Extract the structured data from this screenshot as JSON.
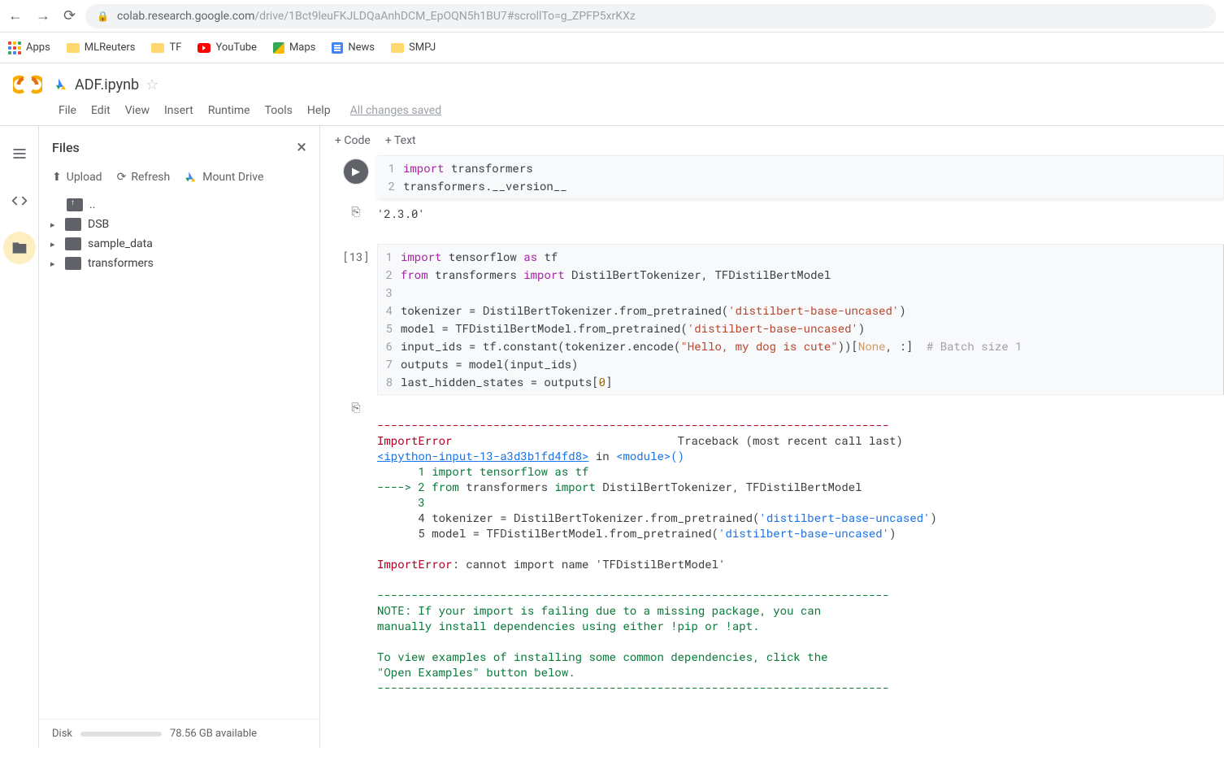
{
  "browser": {
    "url_host": "colab.research.google.com",
    "url_path": "/drive/1Bct9leuFKJLDQaAnhDCM_EpOQN5h1BU7#scrollTo=g_ZPFP5xrKXz"
  },
  "bookmarks": {
    "apps": "Apps",
    "items": [
      "MLReuters",
      "TF",
      "YouTube",
      "Maps",
      "News",
      "SMPJ"
    ]
  },
  "colab": {
    "notebook_title": "ADF.ipynb",
    "menus": [
      "File",
      "Edit",
      "View",
      "Insert",
      "Runtime",
      "Tools",
      "Help"
    ],
    "saved_status": "All changes saved",
    "add_code": "+ Code",
    "add_text": "+ Text"
  },
  "files_panel": {
    "title": "Files",
    "toolbar": {
      "upload": "Upload",
      "refresh": "Refresh",
      "mount": "Mount Drive"
    },
    "tree": {
      "up": "..",
      "items": [
        "DSB",
        "sample_data",
        "transformers"
      ]
    },
    "disk_label": "Disk",
    "disk_available": "78.56 GB available"
  },
  "cell1": {
    "lines": {
      "l1_kw": "import",
      "l1_rest": " transformers",
      "l2": "transformers.__version__"
    },
    "output": "'2.3.0'"
  },
  "cell2": {
    "exec_count": "[13]",
    "lines": {
      "l1_kw": "import",
      "l1_mid": " tensorflow ",
      "l1_as": "as",
      "l1_end": " tf",
      "l2_from": "from",
      "l2_mid": " transformers ",
      "l2_imp": "import",
      "l2_end": " DistilBertTokenizer, TFDistilBertModel",
      "l4_a": "tokenizer = DistilBertTokenizer.from_pretrained(",
      "l4_str": "'distilbert-base-uncased'",
      "l4_b": ")",
      "l5_a": "model = TFDistilBertModel.from_pretrained(",
      "l5_str": "'distilbert-base-uncased'",
      "l5_b": ")",
      "l6_a": "input_ids = tf.constant(tokenizer.encode(",
      "l6_str": "\"Hello, my dog is cute\"",
      "l6_b": "))[",
      "l6_none": "None",
      "l6_c": ", :]  ",
      "l6_cmt": "# Batch size 1",
      "l7": "outputs = model(input_ids)",
      "l8_a": "last_hidden_states = outputs[",
      "l8_num": "0",
      "l8_b": "]"
    },
    "error": {
      "dash": "---------------------------------------------------------------------------",
      "err_name": "ImportError",
      "tb_label": "                                 Traceback (most recent call last)",
      "link": "<ipython-input-13-a3d3b1fd4fd8>",
      "in": " in ",
      "module": "<module>",
      "parens": "()",
      "t1": "      1 import tensorflow as tf",
      "t2_arrow": "----> 2 ",
      "t2_from": "from",
      "t2_mid": " transformers ",
      "t2_imp": "import",
      "t2_rest": " DistilBertTokenizer, TFDistilBertModel",
      "t3": "      3 ",
      "t4_a": "      4 tokenizer = DistilBertTokenizer.from_pretrained(",
      "t4_str": "'distilbert-base-uncased'",
      "t4_b": ")",
      "t5_a": "      5 model = TFDistilBertModel.from_pretrained(",
      "t5_str": "'distilbert-base-uncased'",
      "t5_b": ")",
      "err_line": "ImportError",
      "err_msg": ": cannot import name 'TFDistilBertModel'",
      "note_dash": "---------------------------------------------------------------------------",
      "note1": "NOTE: If your import is failing due to a missing package, you can",
      "note2": "manually install dependencies using either !pip or !apt.",
      "note3": "To view examples of installing some common dependencies, click the",
      "note4": "\"Open Examples\" button below."
    }
  }
}
